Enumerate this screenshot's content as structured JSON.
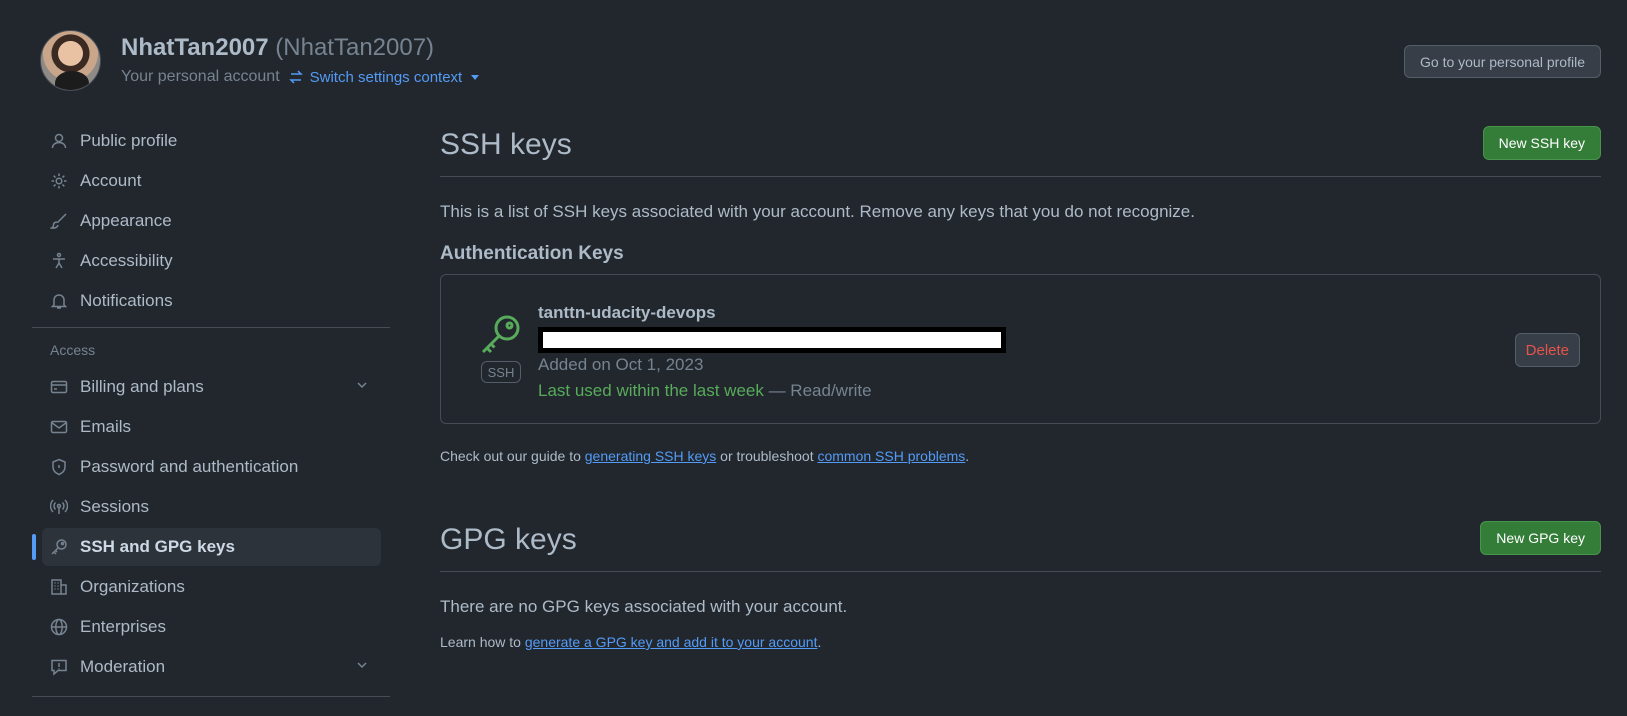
{
  "header": {
    "name": "NhatTan2007",
    "handle": "(NhatTan2007)",
    "subtitle": "Your personal account",
    "switch_context": "Switch settings context",
    "profile_button": "Go to your personal profile"
  },
  "sidebar": {
    "items_top": [
      {
        "label": "Public profile",
        "icon": "person-icon"
      },
      {
        "label": "Account",
        "icon": "gear-icon"
      },
      {
        "label": "Appearance",
        "icon": "paintbrush-icon"
      },
      {
        "label": "Accessibility",
        "icon": "accessibility-icon"
      },
      {
        "label": "Notifications",
        "icon": "bell-icon"
      }
    ],
    "access_label": "Access",
    "items_access": [
      {
        "label": "Billing and plans",
        "icon": "credit-card-icon"
      },
      {
        "label": "Emails",
        "icon": "mail-icon"
      },
      {
        "label": "Password and authentication",
        "icon": "shield-icon"
      },
      {
        "label": "Sessions",
        "icon": "broadcast-icon"
      },
      {
        "label": "SSH and GPG keys",
        "icon": "key-icon"
      },
      {
        "label": "Organizations",
        "icon": "organization-icon"
      },
      {
        "label": "Enterprises",
        "icon": "globe-icon"
      },
      {
        "label": "Moderation",
        "icon": "report-icon"
      }
    ]
  },
  "ssh": {
    "title": "SSH keys",
    "new_button": "New SSH key",
    "description": "This is a list of SSH keys associated with your account. Remove any keys that you do not recognize.",
    "auth_title": "Authentication Keys",
    "key": {
      "name": "tanttn-udacity-devops",
      "badge": "SSH",
      "added": "Added on Oct 1, 2023",
      "last_used": "Last used within the last week",
      "access": " — Read/write",
      "delete": "Delete"
    },
    "guide_prefix": "Check out our guide to ",
    "guide_link": "generating SSH keys",
    "guide_mid": " or troubleshoot ",
    "guide_link2": "common SSH problems",
    "guide_suffix": "."
  },
  "gpg": {
    "title": "GPG keys",
    "new_button": "New GPG key",
    "empty": "There are no GPG keys associated with your account.",
    "learn_prefix": "Learn how to ",
    "learn_link": "generate a GPG key and add it to your account",
    "learn_suffix": "."
  },
  "colors": {
    "background": "#22272e",
    "accent": "#539bf5",
    "green": "#347d39",
    "danger": "#e5534b"
  }
}
